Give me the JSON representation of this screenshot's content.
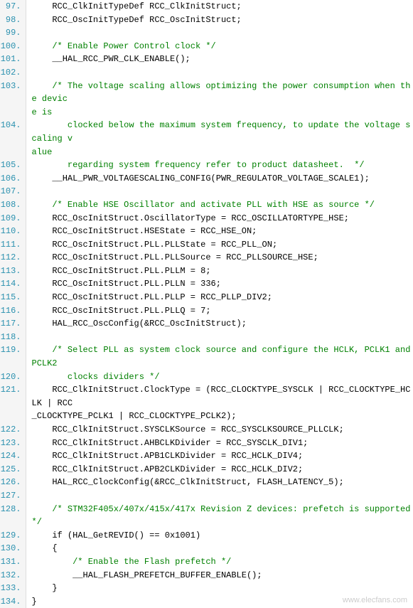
{
  "lines": [
    {
      "num": "97.",
      "content": "    RCC_ClkInitTypeDef RCC_ClkInitStruct;",
      "type": "code"
    },
    {
      "num": "98.",
      "content": "    RCC_OscInitTypeDef RCC_OscInitStruct;",
      "type": "code"
    },
    {
      "num": "99.",
      "content": "",
      "type": "empty"
    },
    {
      "num": "100.",
      "content": "    /* Enable Power Control clock */",
      "type": "comment-line"
    },
    {
      "num": "101.",
      "content": "    __HAL_RCC_PWR_CLK_ENABLE();",
      "type": "code"
    },
    {
      "num": "102.",
      "content": "",
      "type": "empty"
    },
    {
      "num": "103.",
      "content": "    /* The voltage scaling allows optimizing the power consumption when the devic",
      "type": "comment-line"
    },
    {
      "num": "",
      "content": "e is",
      "type": "continuation"
    },
    {
      "num": "104.",
      "content": "       clocked below the maximum system frequency, to update the voltage scaling v",
      "type": "comment-line"
    },
    {
      "num": "",
      "content": "alue",
      "type": "continuation"
    },
    {
      "num": "105.",
      "content": "       regarding system frequency refer to product datasheet.  */",
      "type": "comment-line"
    },
    {
      "num": "106.",
      "content": "    __HAL_PWR_VOLTAGESCALING_CONFIG(PWR_REGULATOR_VOLTAGE_SCALE1);",
      "type": "code"
    },
    {
      "num": "107.",
      "content": "",
      "type": "empty"
    },
    {
      "num": "108.",
      "content": "    /* Enable HSE Oscillator and activate PLL with HSE as source */",
      "type": "comment-line"
    },
    {
      "num": "109.",
      "content": "    RCC_OscInitStruct.OscillatorType = RCC_OSCILLATORTYPE_HSE;",
      "type": "code"
    },
    {
      "num": "110.",
      "content": "    RCC_OscInitStruct.HSEState = RCC_HSE_ON;",
      "type": "code"
    },
    {
      "num": "111.",
      "content": "    RCC_OscInitStruct.PLL.PLLState = RCC_PLL_ON;",
      "type": "code"
    },
    {
      "num": "112.",
      "content": "    RCC_OscInitStruct.PLL.PLLSource = RCC_PLLSOURCE_HSE;",
      "type": "code"
    },
    {
      "num": "113.",
      "content": "    RCC_OscInitStruct.PLL.PLLM = 8;",
      "type": "code"
    },
    {
      "num": "114.",
      "content": "    RCC_OscInitStruct.PLL.PLLN = 336;",
      "type": "code"
    },
    {
      "num": "115.",
      "content": "    RCC_OscInitStruct.PLL.PLLP = RCC_PLLP_DIV2;",
      "type": "code"
    },
    {
      "num": "116.",
      "content": "    RCC_OscInitStruct.PLL.PLLQ = 7;",
      "type": "code"
    },
    {
      "num": "117.",
      "content": "    HAL_RCC_OscConfig(&RCC_OscInitStruct);",
      "type": "code"
    },
    {
      "num": "118.",
      "content": "",
      "type": "empty"
    },
    {
      "num": "119.",
      "content": "    /* Select PLL as system clock source and configure the HCLK, PCLK1 and PCLK2",
      "type": "comment-line"
    },
    {
      "num": "120.",
      "content": "       clocks dividers */",
      "type": "comment-line"
    },
    {
      "num": "121.",
      "content": "    RCC_ClkInitStruct.ClockType = (RCC_CLOCKTYPE_SYSCLK | RCC_CLOCKTYPE_HCLK | RCC",
      "type": "code"
    },
    {
      "num": "",
      "content": "_CLOCKTYPE_PCLK1 | RCC_CLOCKTYPE_PCLK2);",
      "type": "continuation"
    },
    {
      "num": "122.",
      "content": "    RCC_ClkInitStruct.SYSCLKSource = RCC_SYSCLKSOURCE_PLLCLK;",
      "type": "code"
    },
    {
      "num": "123.",
      "content": "    RCC_ClkInitStruct.AHBCLKDivider = RCC_SYSCLK_DIV1;",
      "type": "code"
    },
    {
      "num": "124.",
      "content": "    RCC_ClkInitStruct.APB1CLKDivider = RCC_HCLK_DIV4;",
      "type": "code"
    },
    {
      "num": "125.",
      "content": "    RCC_ClkInitStruct.APB2CLKDivider = RCC_HCLK_DIV2;",
      "type": "code"
    },
    {
      "num": "126.",
      "content": "    HAL_RCC_ClockConfig(&RCC_ClkInitStruct, FLASH_LATENCY_5);",
      "type": "code"
    },
    {
      "num": "127.",
      "content": "",
      "type": "empty"
    },
    {
      "num": "128.",
      "content": "    /* STM32F405x/407x/415x/417x Revision Z devices: prefetch is supported  */",
      "type": "comment-line"
    },
    {
      "num": "129.",
      "content": "    if (HAL_GetREVID() == 0x1001)",
      "type": "code"
    },
    {
      "num": "130.",
      "content": "    {",
      "type": "code"
    },
    {
      "num": "131.",
      "content": "        /* Enable the Flash prefetch */",
      "type": "comment-line"
    },
    {
      "num": "132.",
      "content": "        __HAL_FLASH_PREFETCH_BUFFER_ENABLE();",
      "type": "code"
    },
    {
      "num": "133.",
      "content": "    }",
      "type": "code"
    },
    {
      "num": "134.",
      "content": "}",
      "type": "code"
    }
  ],
  "watermark": "www.elecfans.com"
}
